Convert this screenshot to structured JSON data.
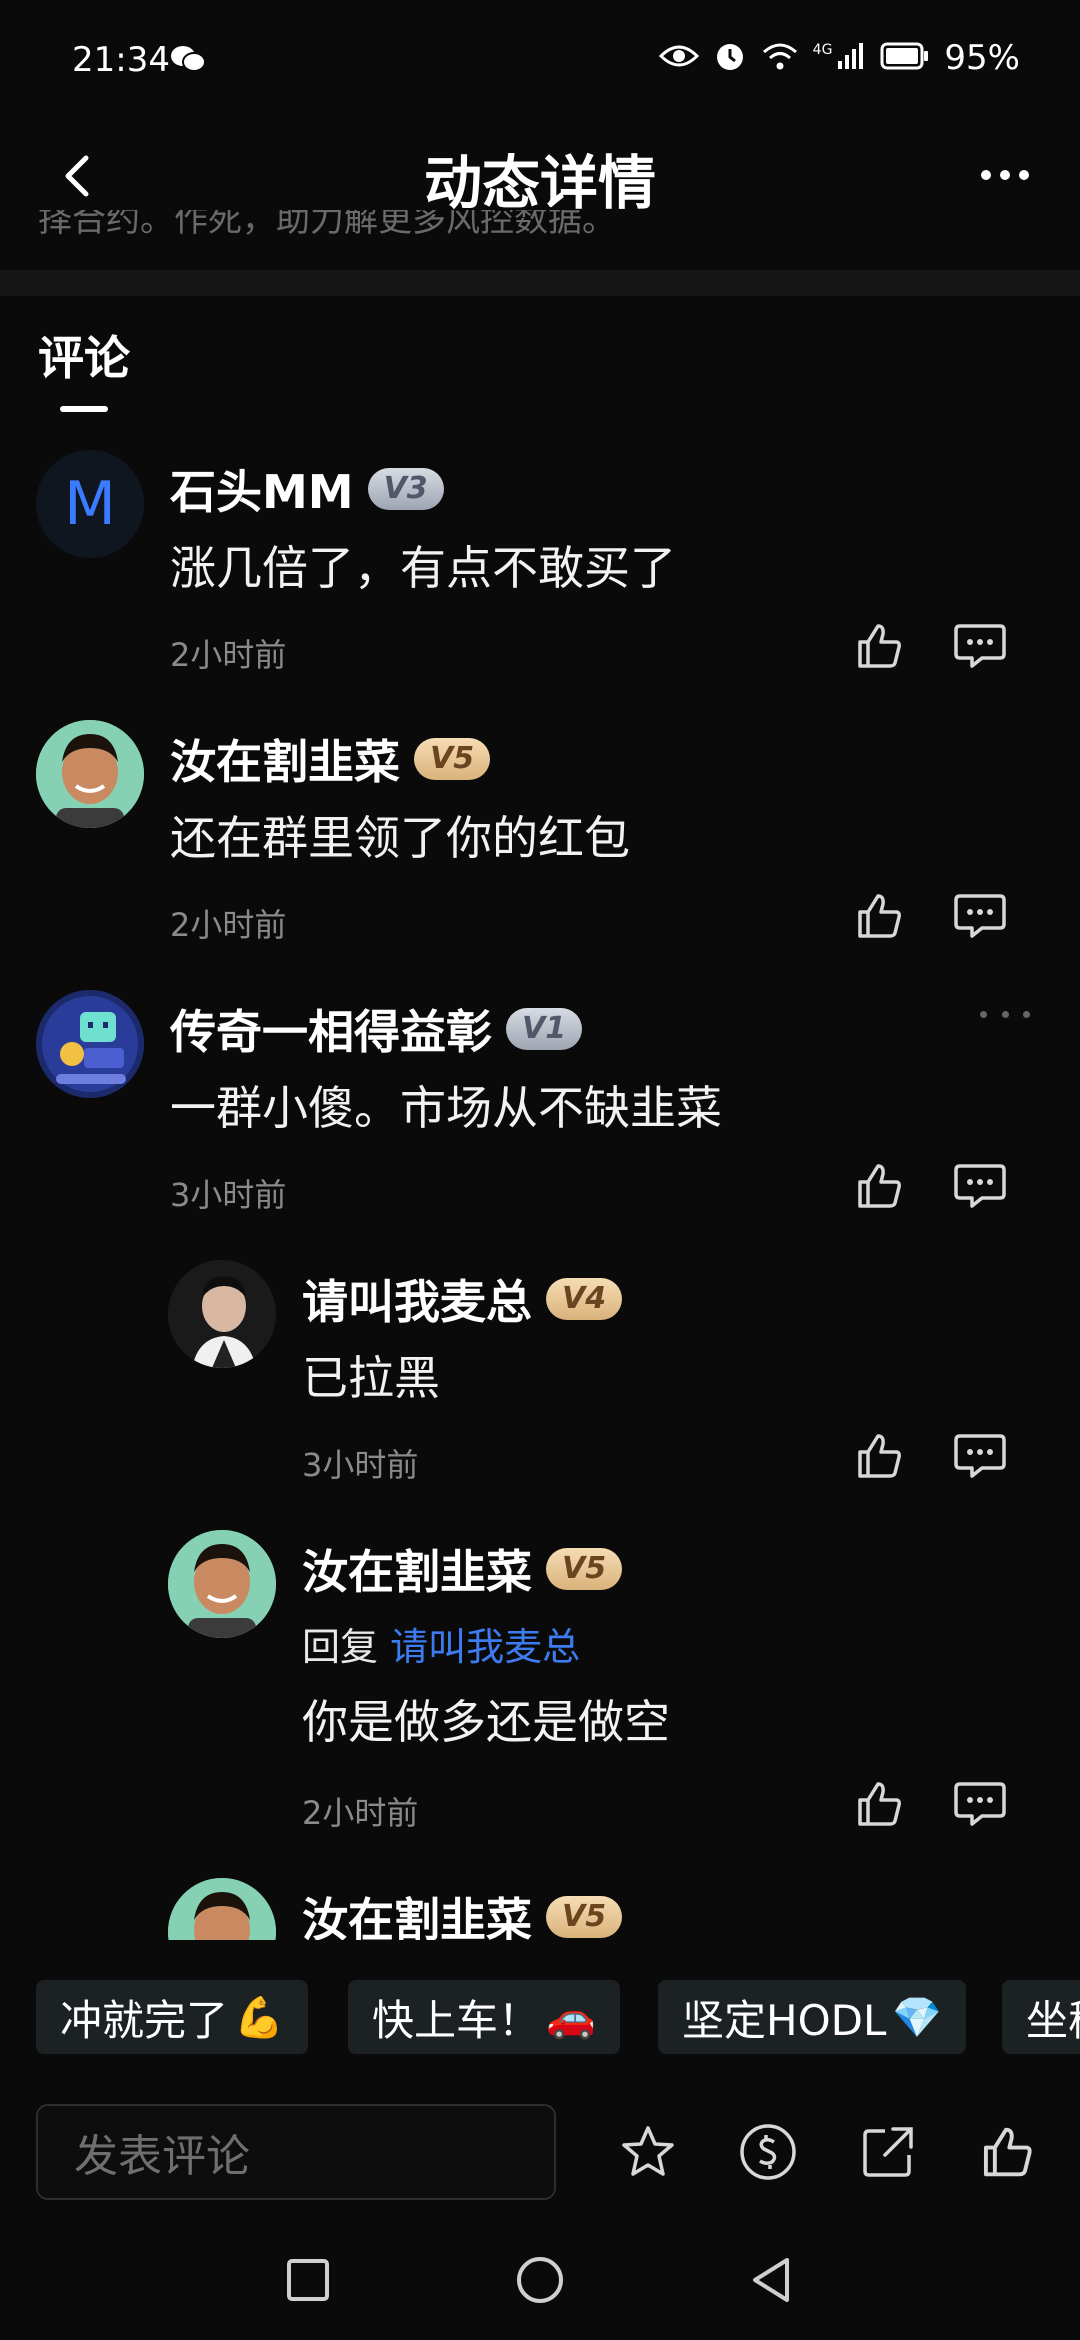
{
  "status_bar": {
    "time": "21:34",
    "network": "4G",
    "battery": "95%"
  },
  "header": {
    "title": "动态详情"
  },
  "previous_text": "择合约。作死，助力解更多风控数据。",
  "section": {
    "tab": "评论"
  },
  "comments": [
    {
      "user": "石头MM",
      "avatar_letter": "M",
      "level": "V3",
      "text": "涨几倍了，有点不敢买了",
      "time": "2小时前"
    },
    {
      "user": "汝在割韭菜",
      "level": "V5",
      "text": "还在群里领了你的红包",
      "time": "2小时前"
    },
    {
      "user": "传奇一相得益彰",
      "level": "V1",
      "text": "一群小傻。市场从不缺韭菜",
      "time": "3小时前"
    }
  ],
  "replies": [
    {
      "user": "请叫我麦总",
      "level": "V4",
      "text": "已拉黑",
      "time": "3小时前"
    },
    {
      "user": "汝在割韭菜",
      "level": "V5",
      "reply_prefix": "回复",
      "reply_to": "请叫我麦总",
      "text": "你是做多还是做空",
      "time": "2小时前"
    },
    {
      "user": "汝在割韭菜",
      "level": "V5"
    }
  ],
  "quick_replies": [
    {
      "label": "冲就完了",
      "emoji": "💪"
    },
    {
      "label": "快上车！",
      "emoji": "🚗"
    },
    {
      "label": "坚定HODL",
      "emoji": "💎"
    },
    {
      "label": "坐稳",
      "emoji": ""
    }
  ],
  "input": {
    "placeholder": "发表评论"
  },
  "colors": {
    "background": "#0a0a0a",
    "mention": "#3d7cf0",
    "badge_gold": "#e8c58e",
    "badge_grey": "#b8bdc7",
    "chip_bg": "#1c2124"
  }
}
